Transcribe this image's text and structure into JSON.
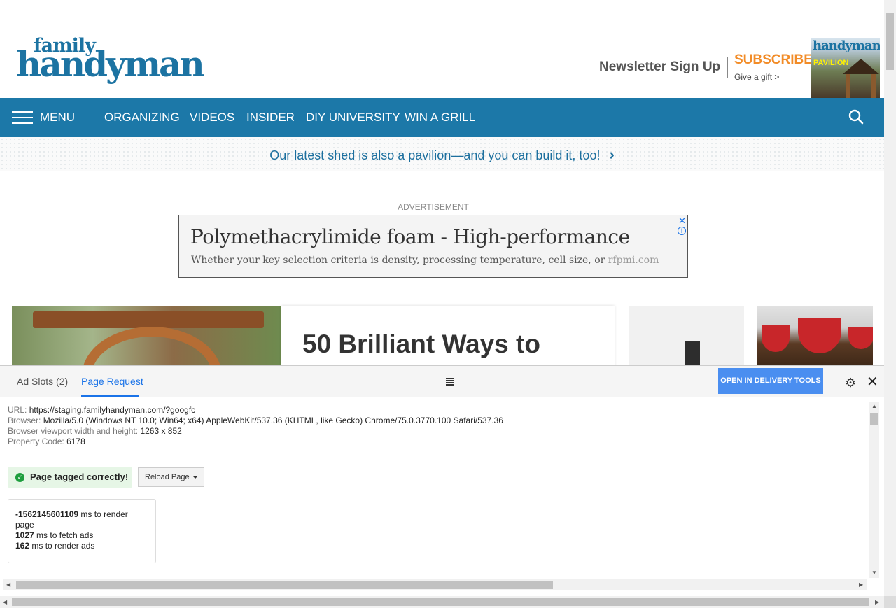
{
  "header": {
    "logo_line1": "family",
    "logo_line2": "handyman",
    "newsletter": "Newsletter Sign Up",
    "subscribe": "SUBSCRIBE",
    "gift": "Give a gift >",
    "magazine": {
      "title": "handyman",
      "headline": "PAVILION"
    }
  },
  "nav": {
    "menu": "MENU",
    "items": [
      "ORGANIZING",
      "VIDEOS",
      "INSIDER",
      "DIY UNIVERSITY",
      "WIN A GRILL"
    ]
  },
  "promo": {
    "text": "Our latest shed is also a pavilion—and you can build it, too!",
    "chevron": "›"
  },
  "ad": {
    "label": "ADVERTISEMENT",
    "title": "Polymethacrylimide foam - High-performance",
    "desc": "Whether your key selection criteria is density, processing temperature, cell size, or",
    "domain": "rfpmi.com"
  },
  "content": {
    "hero_title": "50 Brilliant Ways to"
  },
  "panel": {
    "tabs": [
      "Ad Slots (2)",
      "Page Request"
    ],
    "delivery_button": "OPEN IN DELIVERY TOOLS",
    "info": [
      {
        "key": "URL:",
        "value": "https://staging.familyhandyman.com/?googfc"
      },
      {
        "key": "Browser:",
        "value": "Mozilla/5.0 (Windows NT 10.0; Win64; x64) AppleWebKit/537.36 (KHTML, like Gecko) Chrome/75.0.3770.100 Safari/537.36"
      },
      {
        "key": "Browser viewport width and height:",
        "value": "1263 x 852"
      },
      {
        "key": "Property Code:",
        "value": "6178"
      }
    ],
    "status": "Page tagged correctly!",
    "reload": "Reload Page",
    "timing": [
      {
        "value": "-1562145601109",
        "label": " ms to render page"
      },
      {
        "value": "1027",
        "label": " ms to fetch ads"
      },
      {
        "value": "162",
        "label": " ms to render ads"
      }
    ]
  },
  "colors": {
    "brand": "#1c78a8",
    "subscribe": "#f28c28",
    "accent": "#1a73e8",
    "success": "#1e9e3e"
  }
}
